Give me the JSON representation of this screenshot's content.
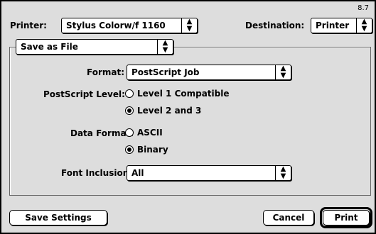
{
  "header": {
    "version": "8.7",
    "printer_label": "Printer:",
    "printer_value": "Stylus Colorw/f 1160",
    "destination_label": "Destination:",
    "destination_value": "Printer"
  },
  "panel_select": {
    "value": "Save as File"
  },
  "format": {
    "label": "Format:",
    "value": "PostScript Job"
  },
  "postscript_level": {
    "label": "PostScript Level:",
    "options": [
      {
        "label": "Level 1 Compatible",
        "selected": false
      },
      {
        "label": "Level 2 and 3",
        "selected": true
      }
    ]
  },
  "data_format": {
    "label": "Data Format:",
    "options": [
      {
        "label": "ASCII",
        "selected": false
      },
      {
        "label": "Binary",
        "selected": true
      }
    ]
  },
  "font_inclusion": {
    "label": "Font Inclusion:",
    "value": "All"
  },
  "buttons": {
    "save_settings": "Save Settings",
    "cancel": "Cancel",
    "print": "Print"
  },
  "icons": {
    "popup_arrows": "updown-arrows-icon"
  }
}
